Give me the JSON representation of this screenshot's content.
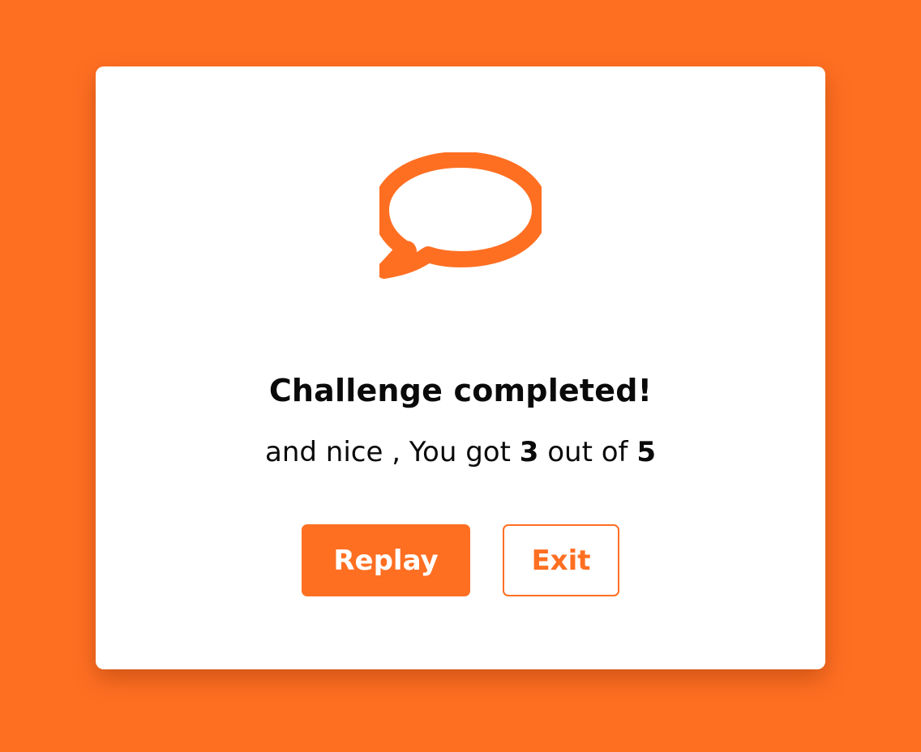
{
  "colors": {
    "accent": "#FF6F22",
    "card_background": "#FFFFFF",
    "text": "#0A0A0A"
  },
  "dialog": {
    "icon": "speech-bubble-icon",
    "title": "Challenge completed!",
    "message": {
      "prefix": "and nice , You got ",
      "score": "3",
      "middle": " out of ",
      "total": "5"
    },
    "buttons": {
      "replay_label": "Replay",
      "exit_label": "Exit"
    }
  }
}
